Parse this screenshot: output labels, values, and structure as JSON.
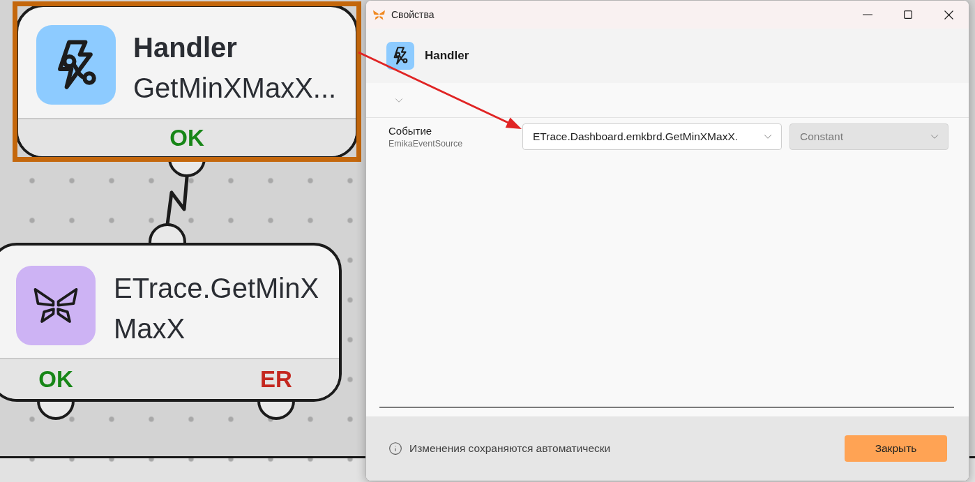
{
  "canvas": {
    "nodes": [
      {
        "kind": "handler",
        "title": "Handler",
        "subtitle": "GetMinXMaxX...",
        "selected": true,
        "outputs": [
          {
            "kind": "ok",
            "label": "OK"
          }
        ]
      },
      {
        "kind": "action",
        "title": "ETrace.GetMinXMaxX",
        "selected": false,
        "outputs": [
          {
            "kind": "ok",
            "label": "OK"
          },
          {
            "kind": "error",
            "label": "ER"
          }
        ]
      }
    ]
  },
  "dialog": {
    "title": "Свойства",
    "header": {
      "kind": "handler",
      "title": "Handler"
    },
    "properties": [
      {
        "label": "Событие",
        "source": "EmikaEventSource",
        "value": "ETrace.Dashboard.emkbrd.GetMinXMaxX.",
        "mode": {
          "value": "Constant",
          "disabled": true
        }
      }
    ],
    "footer": {
      "note": "Изменения сохраняются автоматически",
      "close_button": "Закрыть"
    }
  }
}
